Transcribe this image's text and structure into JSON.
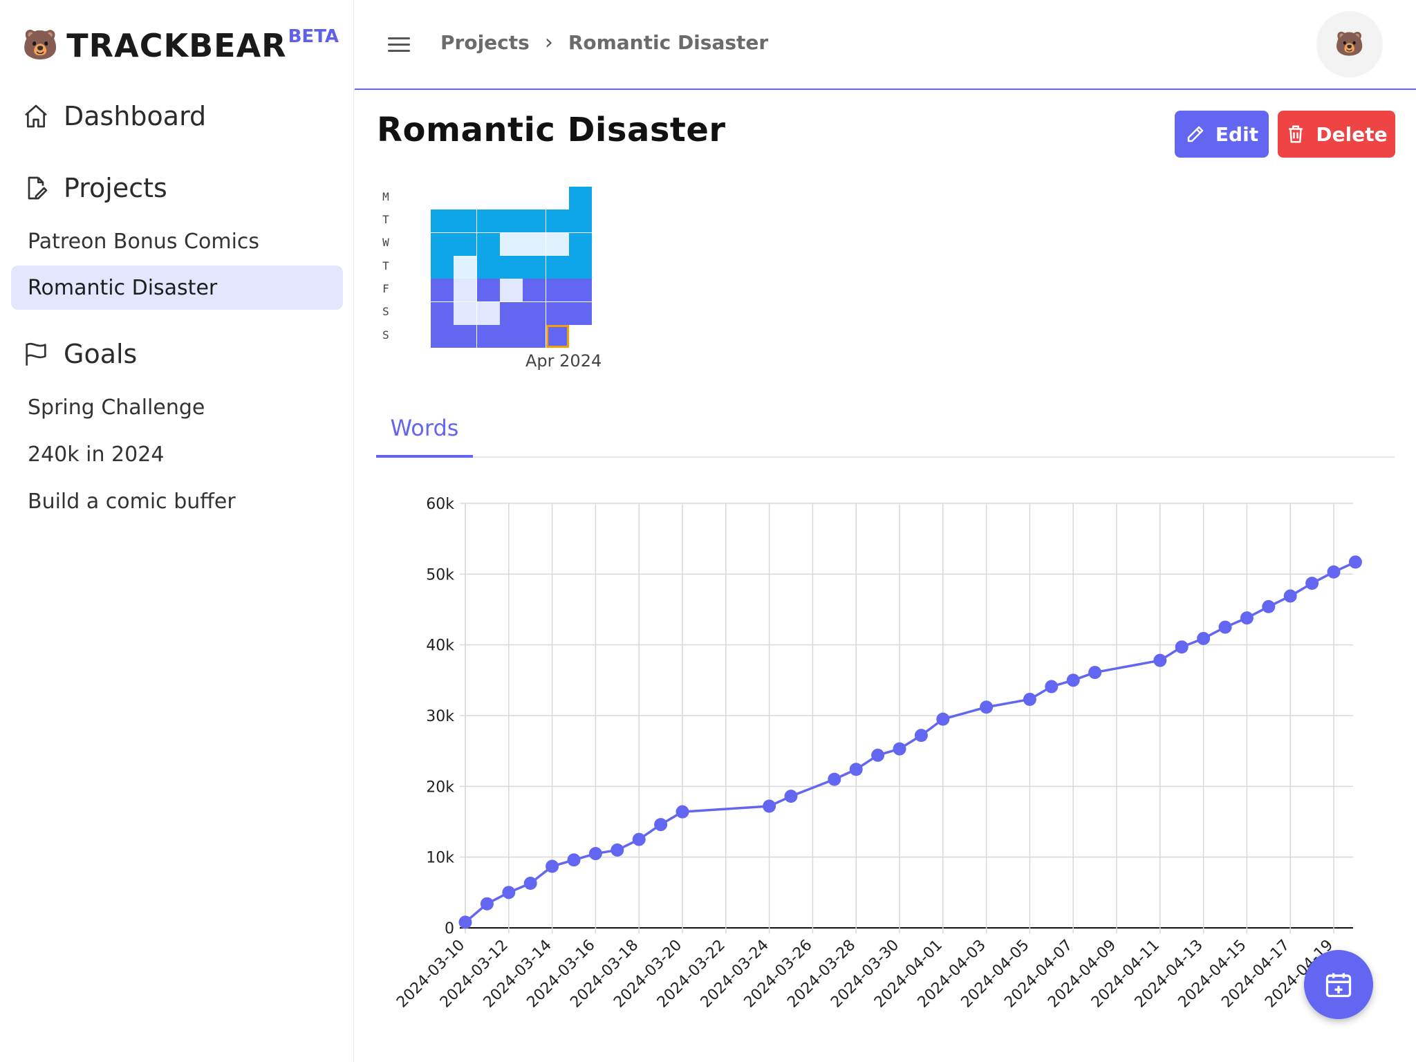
{
  "brand": {
    "logo": "🐻",
    "name": "TRACKBEAR",
    "beta": "BETA"
  },
  "sidebar": {
    "dashboard": {
      "icon": "home-icon",
      "label": "Dashboard"
    },
    "projects": {
      "icon": "edit-document-icon",
      "label": "Projects",
      "items": [
        {
          "label": "Patreon Bonus Comics",
          "active": false
        },
        {
          "label": "Romantic Disaster",
          "active": true
        }
      ]
    },
    "goals": {
      "icon": "flag-icon",
      "label": "Goals",
      "items": [
        {
          "label": "Spring Challenge"
        },
        {
          "label": "240k in 2024"
        },
        {
          "label": "Build a comic buffer"
        }
      ]
    }
  },
  "header": {
    "menu_icon": "hamburger-menu-icon",
    "breadcrumb": {
      "root": "Projects",
      "current": "Romantic Disaster"
    },
    "avatar": "🐻"
  },
  "page": {
    "title": "Romantic Disaster",
    "edit_label": "Edit",
    "delete_label": "Delete",
    "colors": {
      "accent": "#6366f1",
      "danger": "#ef4444",
      "heat_blue": "#0ea5e9",
      "heat_light": "#e0f2fe",
      "heat_lavender": "#e0e7ff"
    }
  },
  "heatmap": {
    "day_labels": [
      "M",
      "T",
      "W",
      "T",
      "F",
      "S",
      "S"
    ],
    "month_label": "Apr 2024",
    "levels": [
      [
        null,
        "blue",
        "blue",
        "blue",
        "purple",
        "purple",
        "purple"
      ],
      [
        null,
        "blue",
        "blue",
        "light",
        "lavender",
        "lavender",
        "purple"
      ],
      [
        null,
        "blue",
        "blue",
        "blue",
        "purple",
        "lavender",
        "purple"
      ],
      [
        null,
        "blue",
        "light",
        "blue",
        "lavender",
        "purple",
        "purple"
      ],
      [
        null,
        "blue",
        "light",
        "blue",
        "purple",
        "purple",
        "purple"
      ],
      [
        null,
        "blue",
        "light",
        "blue",
        "purple",
        "purple",
        "today"
      ],
      [
        "blue",
        "blue",
        "blue",
        "blue",
        "purple",
        "purple",
        null
      ]
    ]
  },
  "tabs": {
    "words": "Words"
  },
  "fab": {
    "icon": "calendar-plus-icon"
  },
  "chart_data": {
    "type": "line",
    "title": "",
    "xlabel": "",
    "ylabel": "",
    "ylim": [
      0,
      60000
    ],
    "yticks": [
      "0",
      "10k",
      "20k",
      "30k",
      "40k",
      "50k",
      "60k"
    ],
    "xticks": [
      "2024-03-10",
      "2024-03-12",
      "2024-03-14",
      "2024-03-16",
      "2024-03-18",
      "2024-03-20",
      "2024-03-22",
      "2024-03-24",
      "2024-03-26",
      "2024-03-28",
      "2024-03-30",
      "2024-04-01",
      "2024-04-03",
      "2024-04-05",
      "2024-04-07",
      "2024-04-09",
      "2024-04-11",
      "2024-04-13",
      "2024-04-15",
      "2024-04-17",
      "2024-04-19"
    ],
    "grid": true,
    "color": "#6366f1",
    "points": [
      {
        "x": "2024-03-10",
        "y": 800
      },
      {
        "x": "2024-03-11",
        "y": 3400
      },
      {
        "x": "2024-03-12",
        "y": 5000
      },
      {
        "x": "2024-03-13",
        "y": 6300
      },
      {
        "x": "2024-03-14",
        "y": 8700
      },
      {
        "x": "2024-03-15",
        "y": 9600
      },
      {
        "x": "2024-03-16",
        "y": 10500
      },
      {
        "x": "2024-03-17",
        "y": 11000
      },
      {
        "x": "2024-03-18",
        "y": 12500
      },
      {
        "x": "2024-03-19",
        "y": 14600
      },
      {
        "x": "2024-03-20",
        "y": 16400
      },
      {
        "x": "2024-03-24",
        "y": 17200
      },
      {
        "x": "2024-03-25",
        "y": 18600
      },
      {
        "x": "2024-03-27",
        "y": 21000
      },
      {
        "x": "2024-03-28",
        "y": 22400
      },
      {
        "x": "2024-03-29",
        "y": 24400
      },
      {
        "x": "2024-03-30",
        "y": 25300
      },
      {
        "x": "2024-03-31",
        "y": 27200
      },
      {
        "x": "2024-04-01",
        "y": 29500
      },
      {
        "x": "2024-04-03",
        "y": 31200
      },
      {
        "x": "2024-04-05",
        "y": 32300
      },
      {
        "x": "2024-04-06",
        "y": 34100
      },
      {
        "x": "2024-04-07",
        "y": 35000
      },
      {
        "x": "2024-04-08",
        "y": 36100
      },
      {
        "x": "2024-04-11",
        "y": 37800
      },
      {
        "x": "2024-04-12",
        "y": 39700
      },
      {
        "x": "2024-04-13",
        "y": 40900
      },
      {
        "x": "2024-04-14",
        "y": 42500
      },
      {
        "x": "2024-04-15",
        "y": 43800
      },
      {
        "x": "2024-04-16",
        "y": 45400
      },
      {
        "x": "2024-04-17",
        "y": 46900
      },
      {
        "x": "2024-04-18",
        "y": 48700
      },
      {
        "x": "2024-04-19",
        "y": 50300
      },
      {
        "x": "2024-04-20",
        "y": 51700
      }
    ]
  }
}
